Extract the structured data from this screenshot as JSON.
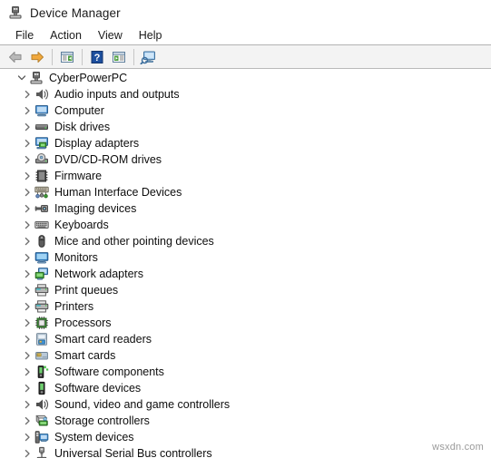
{
  "window": {
    "title": "Device Manager",
    "app_icon": "device-manager-icon"
  },
  "menu": {
    "items": [
      {
        "label": "File"
      },
      {
        "label": "Action"
      },
      {
        "label": "View"
      },
      {
        "label": "Help"
      }
    ]
  },
  "toolbar": {
    "buttons": [
      {
        "name": "back-button",
        "icon": "back-arrow-icon",
        "title": "Back"
      },
      {
        "name": "forward-button",
        "icon": "forward-arrow-icon",
        "title": "Forward"
      },
      {
        "name": "properties-button",
        "icon": "properties-window-icon",
        "title": "Properties"
      },
      {
        "name": "help-button",
        "icon": "question-mark-icon",
        "title": "Help"
      },
      {
        "name": "show-hidden-button",
        "icon": "window-play-icon",
        "title": "Show hidden devices"
      },
      {
        "name": "scan-hardware-button",
        "icon": "scan-monitor-icon",
        "title": "Scan for hardware changes"
      }
    ]
  },
  "tree": {
    "root": {
      "label": "CyberPowerPC",
      "icon": "computer-tower-icon",
      "expanded": true
    },
    "children": [
      {
        "label": "Audio inputs and outputs",
        "icon": "speaker-icon"
      },
      {
        "label": "Computer",
        "icon": "monitor-icon"
      },
      {
        "label": "Disk drives",
        "icon": "disk-drive-icon"
      },
      {
        "label": "Display adapters",
        "icon": "display-adapter-icon"
      },
      {
        "label": "DVD/CD-ROM drives",
        "icon": "optical-drive-icon"
      },
      {
        "label": "Firmware",
        "icon": "chip-icon"
      },
      {
        "label": "Human Interface Devices",
        "icon": "hid-icon"
      },
      {
        "label": "Imaging devices",
        "icon": "imaging-device-icon"
      },
      {
        "label": "Keyboards",
        "icon": "keyboard-icon"
      },
      {
        "label": "Mice and other pointing devices",
        "icon": "mouse-icon"
      },
      {
        "label": "Monitors",
        "icon": "monitor-screen-icon"
      },
      {
        "label": "Network adapters",
        "icon": "network-adapter-icon"
      },
      {
        "label": "Print queues",
        "icon": "printer-icon"
      },
      {
        "label": "Printers",
        "icon": "printer-icon"
      },
      {
        "label": "Processors",
        "icon": "processor-icon"
      },
      {
        "label": "Smart card readers",
        "icon": "smart-card-reader-icon"
      },
      {
        "label": "Smart cards",
        "icon": "smart-card-icon"
      },
      {
        "label": "Software components",
        "icon": "software-component-icon"
      },
      {
        "label": "Software devices",
        "icon": "software-device-icon"
      },
      {
        "label": "Sound, video and game controllers",
        "icon": "sound-controller-icon"
      },
      {
        "label": "Storage controllers",
        "icon": "storage-controller-icon"
      },
      {
        "label": "System devices",
        "icon": "system-device-icon"
      },
      {
        "label": "Universal Serial Bus controllers",
        "icon": "usb-controller-icon"
      }
    ]
  },
  "watermark": {
    "text": "wsxdn.com"
  },
  "colors": {
    "toolbar_bg": "#f3f3f3",
    "separator": "#b3b3b3",
    "text": "#0d0d0d",
    "chevron": "#6d6d6d",
    "accent_blue": "#3a7cc4",
    "accent_green": "#3f9c35"
  }
}
